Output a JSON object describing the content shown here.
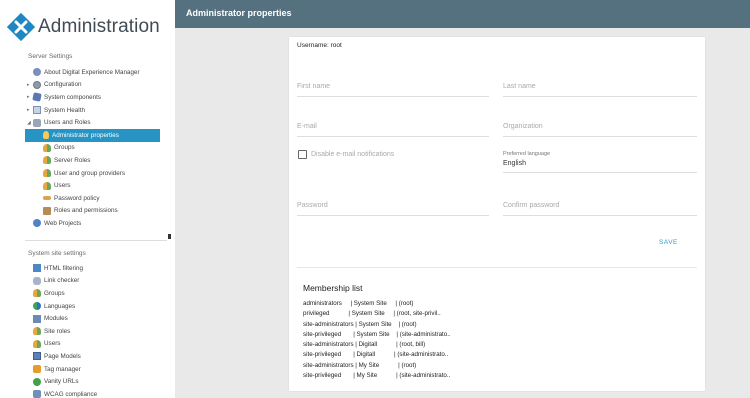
{
  "app": {
    "title": "Administration"
  },
  "header": {
    "title": "Administrator properties"
  },
  "sidebar": {
    "server_section": "Server Settings",
    "server_items": [
      {
        "label": "About Digital Experience Manager",
        "icon": "info-icon",
        "level": 1,
        "arrow": ""
      },
      {
        "label": "Configuration",
        "icon": "gear-icon",
        "level": 1,
        "arrow": "▸"
      },
      {
        "label": "System components",
        "icon": "components-icon",
        "level": 1,
        "arrow": "▸"
      },
      {
        "label": "System Health",
        "icon": "health-icon",
        "level": 1,
        "arrow": "▸"
      },
      {
        "label": "Users and Roles",
        "icon": "users-roles-icon",
        "level": 1,
        "arrow": "◢"
      },
      {
        "label": "Administrator properties",
        "icon": "admin-icon",
        "level": 2,
        "arrow": "",
        "selected": true
      },
      {
        "label": "Groups",
        "icon": "groups-icon",
        "level": 2,
        "arrow": ""
      },
      {
        "label": "Server Roles",
        "icon": "server-roles-icon",
        "level": 2,
        "arrow": ""
      },
      {
        "label": "User and group providers",
        "icon": "providers-icon",
        "level": 2,
        "arrow": ""
      },
      {
        "label": "Users",
        "icon": "users-icon",
        "level": 2,
        "arrow": ""
      },
      {
        "label": "Password policy",
        "icon": "key-icon",
        "level": 2,
        "arrow": ""
      },
      {
        "label": "Roles and permissions",
        "icon": "roles-icon",
        "level": 2,
        "arrow": ""
      },
      {
        "label": "Web Projects",
        "icon": "web-icon",
        "level": 1,
        "arrow": ""
      }
    ],
    "site_section": "System site settings",
    "site_items": [
      {
        "label": "HTML filtering",
        "icon": "html-icon"
      },
      {
        "label": "Link checker",
        "icon": "link-icon"
      },
      {
        "label": "Groups",
        "icon": "groups-icon"
      },
      {
        "label": "Languages",
        "icon": "languages-icon"
      },
      {
        "label": "Modules",
        "icon": "modules-icon"
      },
      {
        "label": "Site roles",
        "icon": "site-roles-icon"
      },
      {
        "label": "Users",
        "icon": "users-icon"
      },
      {
        "label": "Page Models",
        "icon": "page-models-icon"
      },
      {
        "label": "Tag manager",
        "icon": "tag-icon"
      },
      {
        "label": "Vanity URLs",
        "icon": "vanity-icon"
      },
      {
        "label": "WCAG compliance",
        "icon": "wcag-icon"
      }
    ]
  },
  "form": {
    "username_label": "Username: root",
    "first_name": {
      "placeholder": "First name",
      "value": ""
    },
    "last_name": {
      "placeholder": "Last name",
      "value": ""
    },
    "email": {
      "placeholder": "E-mail",
      "value": ""
    },
    "organization": {
      "placeholder": "Organization",
      "value": ""
    },
    "disable_email": {
      "label": "Disable e-mail notifications",
      "checked": false
    },
    "preferred_language": {
      "label": "Preferred language",
      "value": "English"
    },
    "password": {
      "placeholder": "Password",
      "value": ""
    },
    "confirm_password": {
      "placeholder": "Confirm password",
      "value": ""
    },
    "save_label": "SAVE"
  },
  "membership": {
    "title": "Membership list",
    "rows": [
      "administrators     | System Site     | (root)",
      "privileged           | System Site     | (root, site-privil..",
      "site-administrators | System Site    | (root)",
      "site-privileged       | System Site    | (site-administrato..",
      "site-administrators | Digitall           | (root, bill)",
      "site-privileged       | Digitall           | (site-administrato..",
      "site-administrators | My Site           | (root)",
      "site-privileged       | My Site           | (site-administrato.."
    ]
  },
  "colors": {
    "header_bg": "#55707e",
    "selected_bg": "#2894c3",
    "save_color": "#2a9fd6",
    "logo_blue": "#1f88c2"
  }
}
